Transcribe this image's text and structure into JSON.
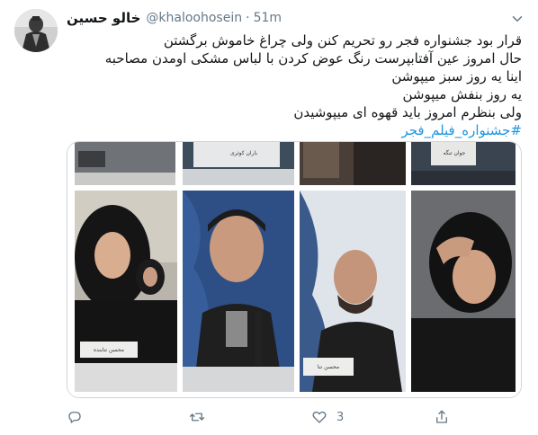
{
  "tweet": {
    "display_name": "خالو حسین",
    "handle": "@khaloohosein",
    "separator": "·",
    "time": "51m",
    "text_lines": [
      "قرار بود جشنواره فجر رو تحریم کنن ولی چراغ خاموش برگشتن",
      "حال امروز عین آفتابپرست رنگ عوض کردن با لباس مشکی اومدن مصاحبه",
      "اینا یه روز سبز میپوشن",
      "یه روز بنفش میپوشن",
      "ولی بنظرم امروز باید قهوه ای میپوشیدن"
    ],
    "hashtag": "#جشنواره_فیلم_فجر"
  },
  "media": {
    "nameplates": [
      "باران کوثری",
      "جوان تنگه",
      "محسن تنابنده",
      "محسن تنا"
    ],
    "nameplate_sub": "بازیگر"
  },
  "actions": {
    "reply_icon": "reply-icon",
    "retweet_icon": "retweet-icon",
    "like_icon": "heart-icon",
    "like_count": "3",
    "share_icon": "share-icon"
  },
  "colors": {
    "text": "#14171a",
    "muted": "#657786",
    "link": "#1b95e0",
    "border": "#ccd6dd"
  }
}
